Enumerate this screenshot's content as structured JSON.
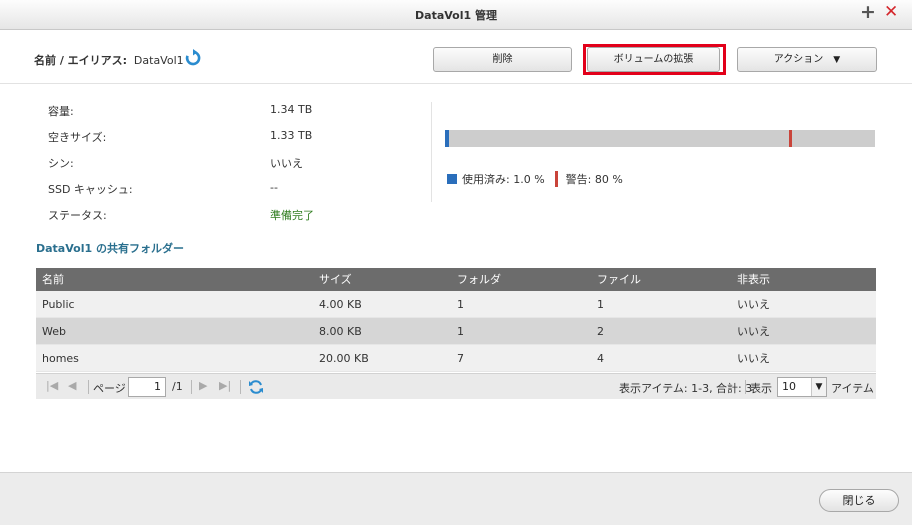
{
  "window": {
    "title": "DataVol1 管理",
    "plus_glyph": "+",
    "close_glyph": "✕"
  },
  "header": {
    "label": "名前 / エイリアス:",
    "volume": "DataVol1",
    "buttons": {
      "delete": "削除",
      "expand": "ボリュームの拡張",
      "action": "アクション",
      "action_arrow": "▼"
    },
    "highlight_color": "#e2001a"
  },
  "properties": [
    {
      "label": "容量:",
      "value": "1.34 TB"
    },
    {
      "label": "空きサイズ:",
      "value": "1.33 TB"
    },
    {
      "label": "シン:",
      "value": "いいえ"
    },
    {
      "label": "SSD キャッシュ:",
      "value": "--"
    },
    {
      "label": "ステータス:",
      "value": "準備完了"
    }
  ],
  "usage": {
    "used_fraction": 0.01,
    "warn_fraction": 0.8,
    "used_text": "使用済み: 1.0 %",
    "warn_text": "警告: 80 %",
    "used_color": "#2a6ebb",
    "warn_color": "#c9443a"
  },
  "shared_folders": {
    "title": "DataVol1 の共有フォルダー",
    "columns": [
      "名前",
      "サイズ",
      "フォルダ",
      "ファイル",
      "非表示"
    ],
    "rows": [
      [
        "Public",
        "4.00 KB",
        "1",
        "1",
        "いいえ"
      ],
      [
        "Web",
        "8.00 KB",
        "1",
        "2",
        "いいえ"
      ],
      [
        "homes",
        "20.00 KB",
        "7",
        "4",
        "いいえ"
      ]
    ]
  },
  "pager": {
    "page_label": "ページ",
    "current_page": "1",
    "total_pages": "/1",
    "display_items": "表示アイテム: 1-3, 合計: 3",
    "show_label": "表示",
    "page_size": "10",
    "items_label": "アイテム"
  },
  "footer": {
    "close": "閉じる"
  }
}
